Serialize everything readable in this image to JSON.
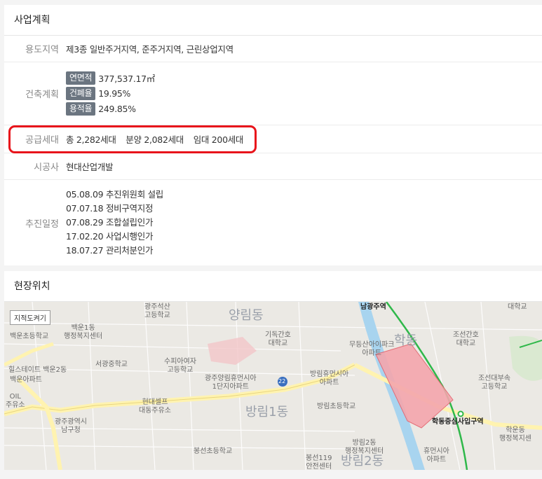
{
  "plan": {
    "title": "사업계획",
    "use_zone": {
      "label": "용도지역",
      "value": "제3종 일반주거지역, 준주거지역, 근린상업지역"
    },
    "build": {
      "label": "건축계획",
      "items": [
        {
          "tag": "연면적",
          "value": "377,537.17㎡"
        },
        {
          "tag": "건폐율",
          "value": "19.95%"
        },
        {
          "tag": "용적율",
          "value": "249.85%"
        }
      ]
    },
    "supply": {
      "label": "공급세대",
      "total": "총 2,282세대",
      "sale": "분양 2,082세대",
      "rent": "임대 200세대"
    },
    "builder": {
      "label": "시공사",
      "value": "현대산업개발"
    },
    "schedule": {
      "label": "추진일정",
      "items": [
        "05.08.09 추진위원회 설립",
        "07.07.18 정비구역지정",
        "07.08.29 조합설립인가",
        "17.02.20 사업시행인가",
        "18.07.27 관리처분인가"
      ]
    }
  },
  "location": {
    "title": "현장위치",
    "cad_button": "지적도켜기",
    "labels": {
      "l1": "광주석산\n고등학교",
      "l2": "양림동",
      "l3": "남광주역",
      "l4": "대학교",
      "l5": "백운1동\n행정복지센터",
      "l6": "힐스테이트 백운2동",
      "l7": "백운아파트",
      "l8": "서광중학교",
      "l9": "수피아여자\n고등학교",
      "l10": "기독간호\n대학교",
      "l11": "무등산아이파크\n아파트",
      "l12": "학동",
      "l13": "조선간호\n대학교",
      "l14": "광주양림휴먼시아\n1단지아파트",
      "l15": "방림휴먼시아\n아파트",
      "l16": "조선대부속\n고등학교",
      "l17": "현대셀프\n대동주유소",
      "l18": "방림1동",
      "l19": "방림초등학교",
      "l20": "학동증심사입구역",
      "l21": "광주광역시\n남구청",
      "l22": "봉선초등학교",
      "l23": "방림2동\n행정복지센터",
      "l24": "방림2동",
      "l25": "휴먼시아\n아파트",
      "l26": "학운동\n행정복지센",
      "l27": "봉선119\n안전센터",
      "l28": "백운초등학교",
      "l29": "OIL\n주유소",
      "l30": "22"
    },
    "colors": {
      "road": "#fff3b0",
      "target": "#f4a6ad",
      "river": "#a8d4ef",
      "rail": "#2fb84a"
    }
  }
}
